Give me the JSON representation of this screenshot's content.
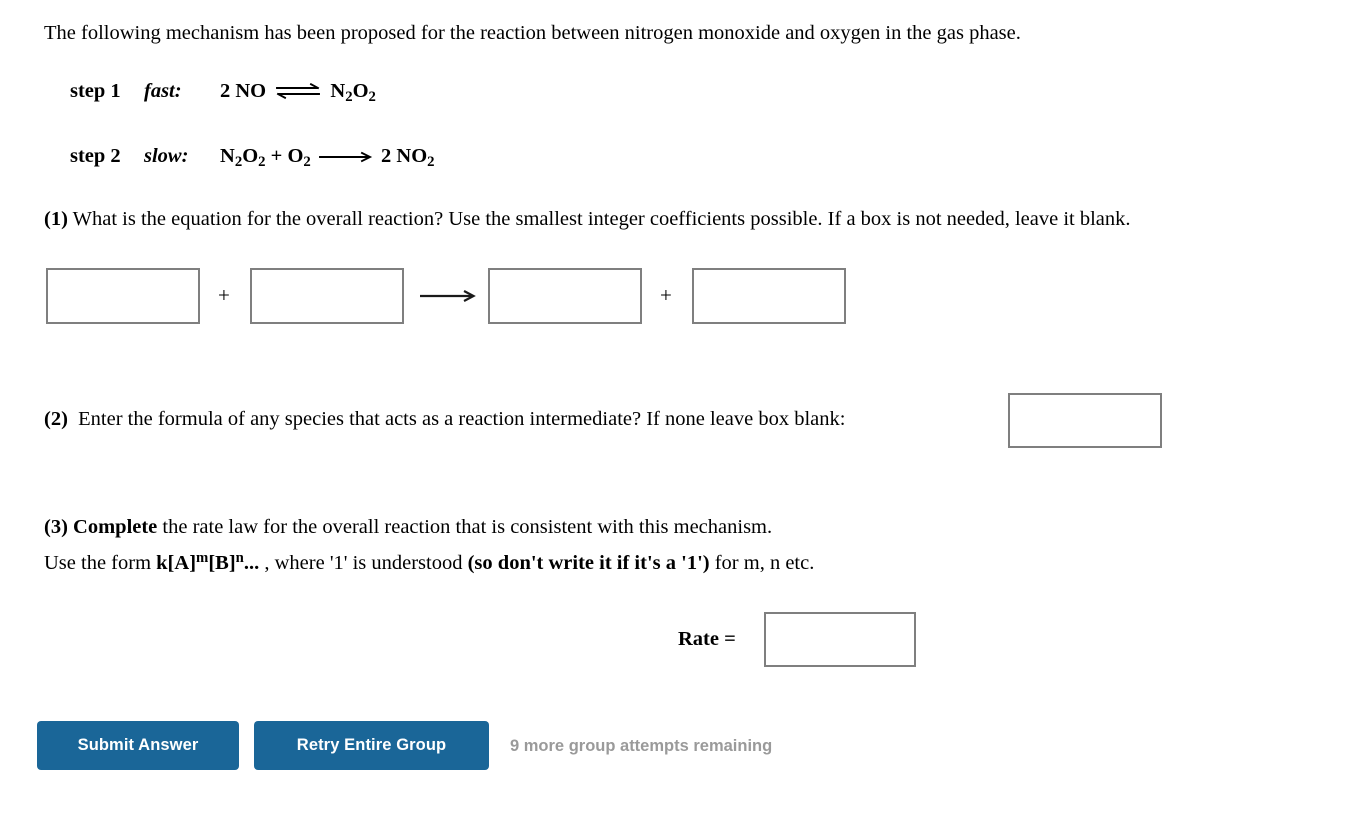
{
  "intro": "The following mechanism has been proposed for the reaction between nitrogen monoxide and oxygen in the gas phase.",
  "mechanism": {
    "steps": [
      {
        "label": "step 1",
        "speed": "fast:",
        "left": "2 NO",
        "arrow": "equilibrium-double-arrow",
        "right_parts": [
          {
            "text": "N",
            "type": "normal"
          },
          {
            "text": "2",
            "type": "sub"
          },
          {
            "text": "O",
            "type": "normal"
          },
          {
            "text": "2",
            "type": "sub"
          }
        ],
        "right_plain": "N2O2"
      },
      {
        "label": "step 2",
        "speed": "slow:",
        "left_parts": [
          {
            "text": "N",
            "type": "normal"
          },
          {
            "text": "2",
            "type": "sub"
          },
          {
            "text": "O",
            "type": "normal"
          },
          {
            "text": "2",
            "type": "sub"
          },
          {
            "text": " + O",
            "type": "normal"
          },
          {
            "text": "2",
            "type": "sub"
          }
        ],
        "left_plain": "N2O2 + O2",
        "arrow": "right-arrow",
        "right_parts": [
          {
            "text": "2 NO",
            "type": "normal"
          },
          {
            "text": "2",
            "type": "sub"
          }
        ],
        "right_plain": "2 NO2"
      }
    ]
  },
  "q1": {
    "number": "(1)",
    "text": " What is the equation for the overall reaction? Use the smallest integer coefficients possible. If a box is not needed, leave it blank.",
    "operators": {
      "plus1": "+",
      "arrow": "⟶",
      "plus2": "+"
    },
    "boxes": [
      {
        "name": "reactant-1",
        "value": "",
        "placeholder": ""
      },
      {
        "name": "reactant-2",
        "value": "",
        "placeholder": ""
      },
      {
        "name": "product-1",
        "value": "",
        "placeholder": ""
      },
      {
        "name": "product-2",
        "value": "",
        "placeholder": ""
      }
    ]
  },
  "q2": {
    "number": "(2)",
    "text": "Enter the formula of any species that acts as a reaction intermediate? If none leave box blank:",
    "box": {
      "name": "intermediate",
      "value": "",
      "placeholder": ""
    }
  },
  "q3": {
    "number": "(3)",
    "bold_lead": "Complete",
    "line1_rest": " the rate law for the overall reaction that is consistent with this mechanism.",
    "line2_prefix": "Use the form ",
    "form": {
      "k": "k[A]",
      "m": "m",
      "b": "[B]",
      "n": "n",
      "ellipsis": "..."
    },
    "line2_mid": " , where '1' is understood ",
    "line2_bold": "(so don't write it if it's a '1')",
    "line2_suffix": " for m, n etc.",
    "rate_label": "Rate =",
    "box": {
      "name": "rate-law",
      "value": "",
      "placeholder": ""
    }
  },
  "actions": {
    "submit_label": "Submit Answer",
    "retry_label": "Retry Entire Group",
    "attempts_text": "9 more group attempts remaining"
  },
  "colors": {
    "button_blue": "#1a6698",
    "box_border": "#7f7f7f",
    "attempts_gray": "#9a9a9a",
    "text": "#000000"
  }
}
